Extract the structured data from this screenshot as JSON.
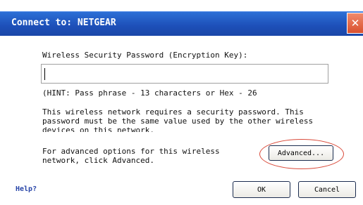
{
  "dialog": {
    "title": "Connect to: NETGEAR",
    "close_glyph": "✕"
  },
  "password": {
    "label": "Wireless Security Password (Encryption Key):",
    "value": "",
    "hint": "(HINT: Pass phrase - 13 characters or Hex - 26",
    "description_line1": "This wireless network requires a security password. This",
    "description_line2": "password must be the same value used by the other wireless",
    "description_line3": "devices on this network."
  },
  "advanced": {
    "text_line1": "For advanced options for this wireless",
    "text_line2": "network, click Advanced.",
    "button_label": "Advanced..."
  },
  "footer": {
    "help_label": "Help?",
    "ok_label": "OK",
    "cancel_label": "Cancel"
  },
  "colors": {
    "titlebar": "#1d4fb8",
    "highlight": "#d94a3a"
  }
}
